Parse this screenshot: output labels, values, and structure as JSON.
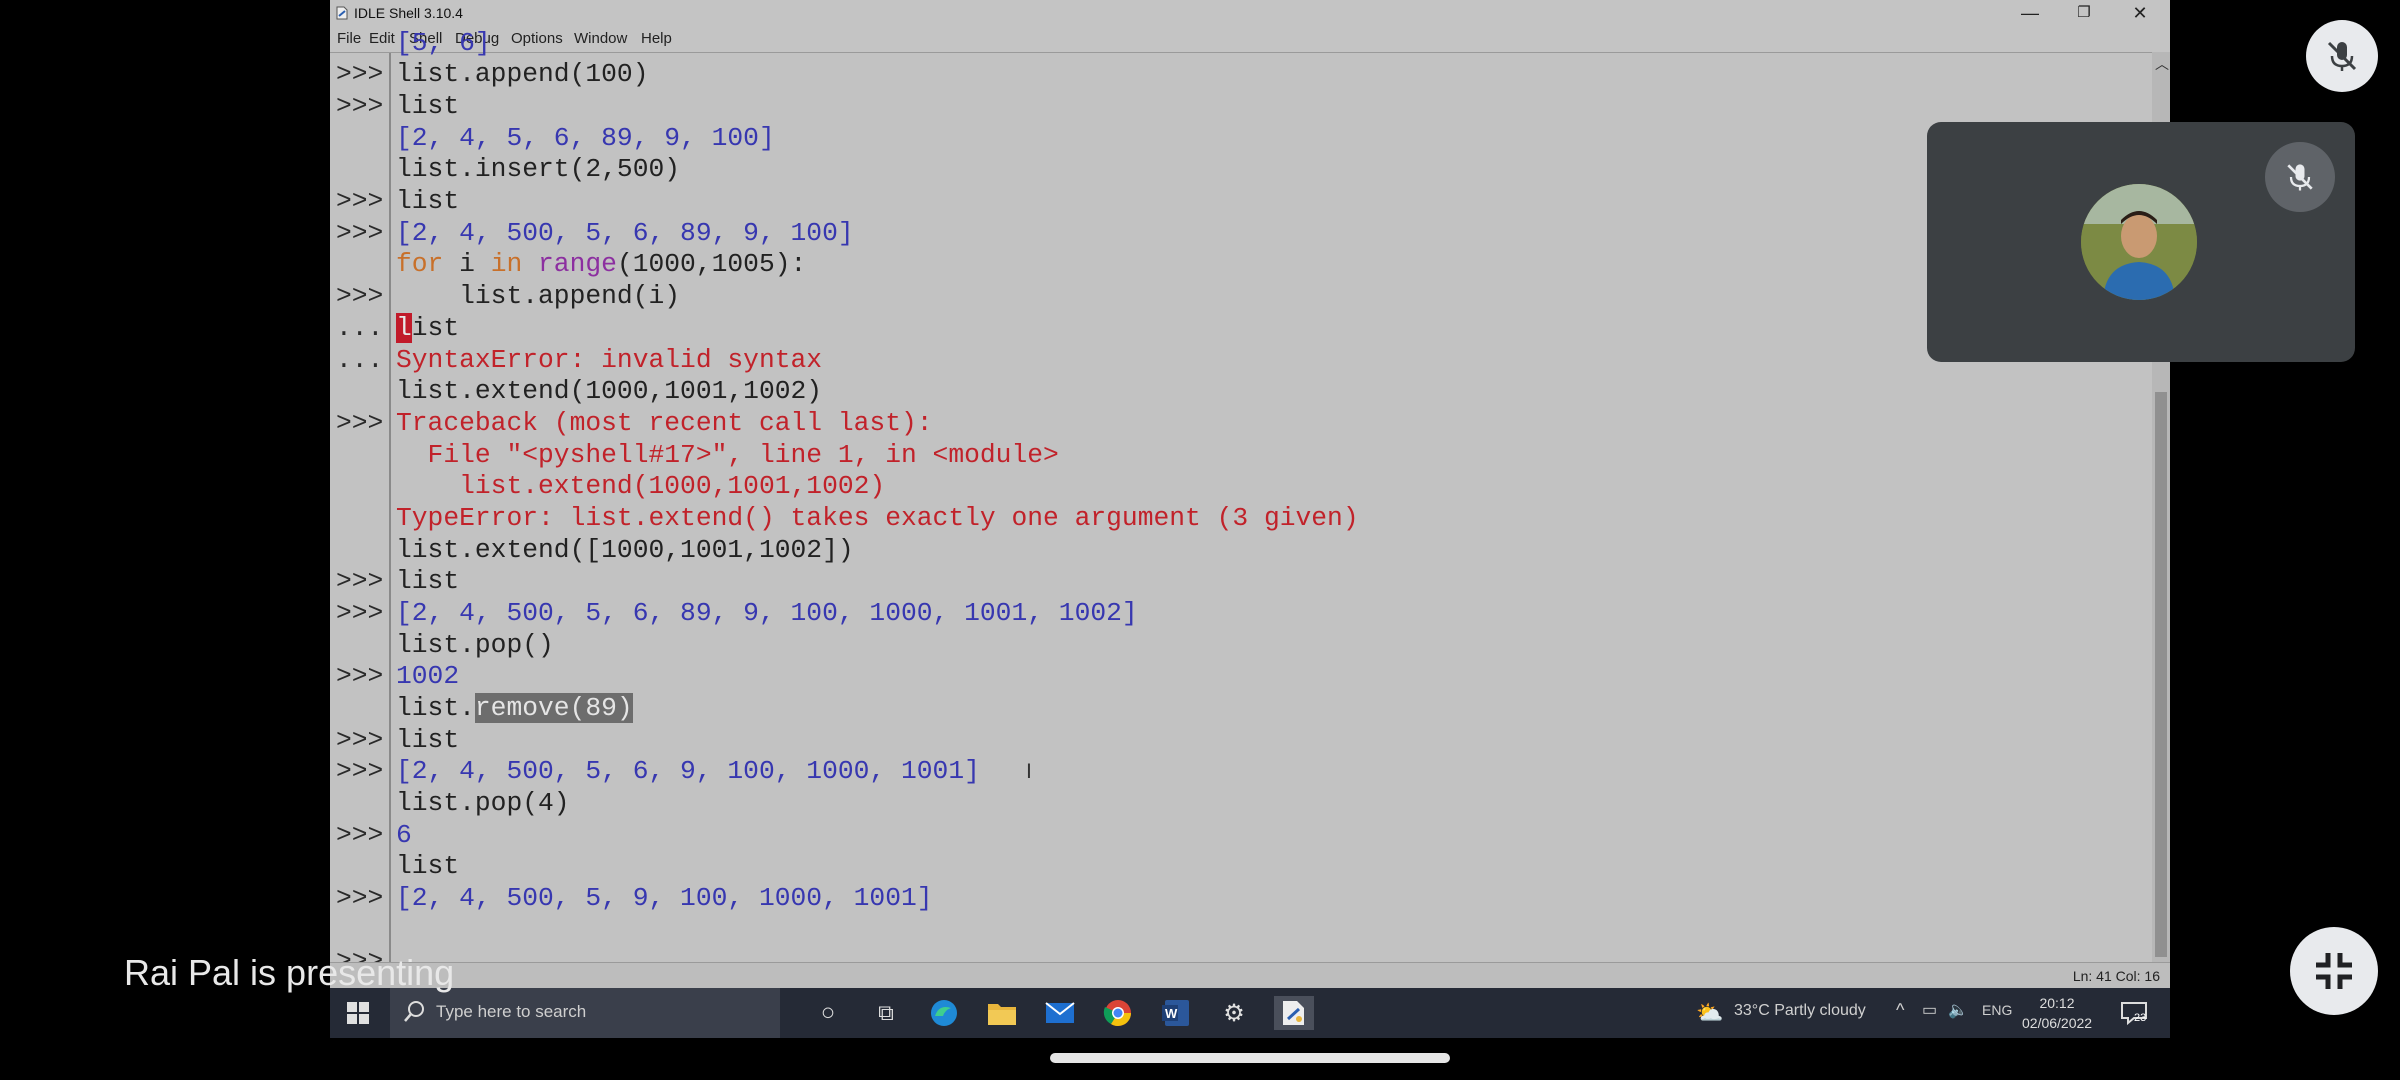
{
  "window": {
    "title": "IDLE Shell 3.10.4",
    "controls": {
      "minimize": "—",
      "maximize": "❐",
      "close": "✕"
    }
  },
  "menu": [
    "File",
    "Edit",
    "Shell",
    "Debug",
    "Options",
    "Window",
    "Help"
  ],
  "shell": {
    "prompts": [
      ">>>",
      ">>>",
      "",
      ">>>",
      ">>>",
      "",
      ">>>",
      "...",
      "...",
      "",
      ">>>",
      "",
      "",
      "",
      "",
      ">>>",
      ">>>",
      "",
      ">>>",
      "",
      ">>>",
      ">>>",
      "",
      ">>>",
      "",
      ">>>",
      "",
      ">>>"
    ],
    "lines": {
      "l0": "[5, 6]",
      "l1": "list.append(100)",
      "l2": "list",
      "l3": "[2, 4, 5, 6, 89, 9, 100]",
      "l4": "list.insert(2,500)",
      "l5": "list",
      "l6": "[2, 4, 500, 5, 6, 89, 9, 100]",
      "l7_for": "for",
      "l7_i": " i ",
      "l7_in": "in",
      "l7_sp": " ",
      "l7_range": "range",
      "l7_rest": "(1000,1005):",
      "l8": "    list.append(i)",
      "l9_cursor": "l",
      "l9_rest": "ist",
      "l10": "SyntaxError: invalid syntax",
      "l11": "list.extend(1000,1001,1002)",
      "l12": "Traceback (most recent call last):",
      "l13": "  File \"<pyshell#17>\", line 1, in <module>",
      "l14": "    list.extend(1000,1001,1002)",
      "l15": "TypeError: list.extend() takes exactly one argument (3 given)",
      "l16": "list.extend([1000,1001,1002])",
      "l17": "list",
      "l18": "[2, 4, 500, 5, 6, 89, 9, 100, 1000, 1001, 1002]",
      "l19": "list.pop()",
      "l20": "1002",
      "l21_pre": "list.",
      "l21_sel": "remove(89)",
      "l22": "list",
      "l23": "[2, 4, 500, 5, 6, 9, 100, 1000, 1001]",
      "l24": "list.pop(4)",
      "l25": "6",
      "l26": "list",
      "l27": "[2, 4, 500, 5, 9, 100, 1000, 1001]"
    }
  },
  "status": {
    "position": "Ln: 41   Col: 16"
  },
  "taskbar": {
    "search_placeholder": "Type here to search",
    "weather": "33°C  Partly cloudy",
    "language": "ENG",
    "time": "20:12",
    "date": "02/06/2022",
    "notifications": "23"
  },
  "meeting": {
    "presenting_label": "Rai Pal is presenting"
  },
  "colors": {
    "keyword": "#c8702a",
    "builtin": "#8c2fa0",
    "output": "#3737b0",
    "error": "#c1222a",
    "tile": "#3c4043"
  }
}
